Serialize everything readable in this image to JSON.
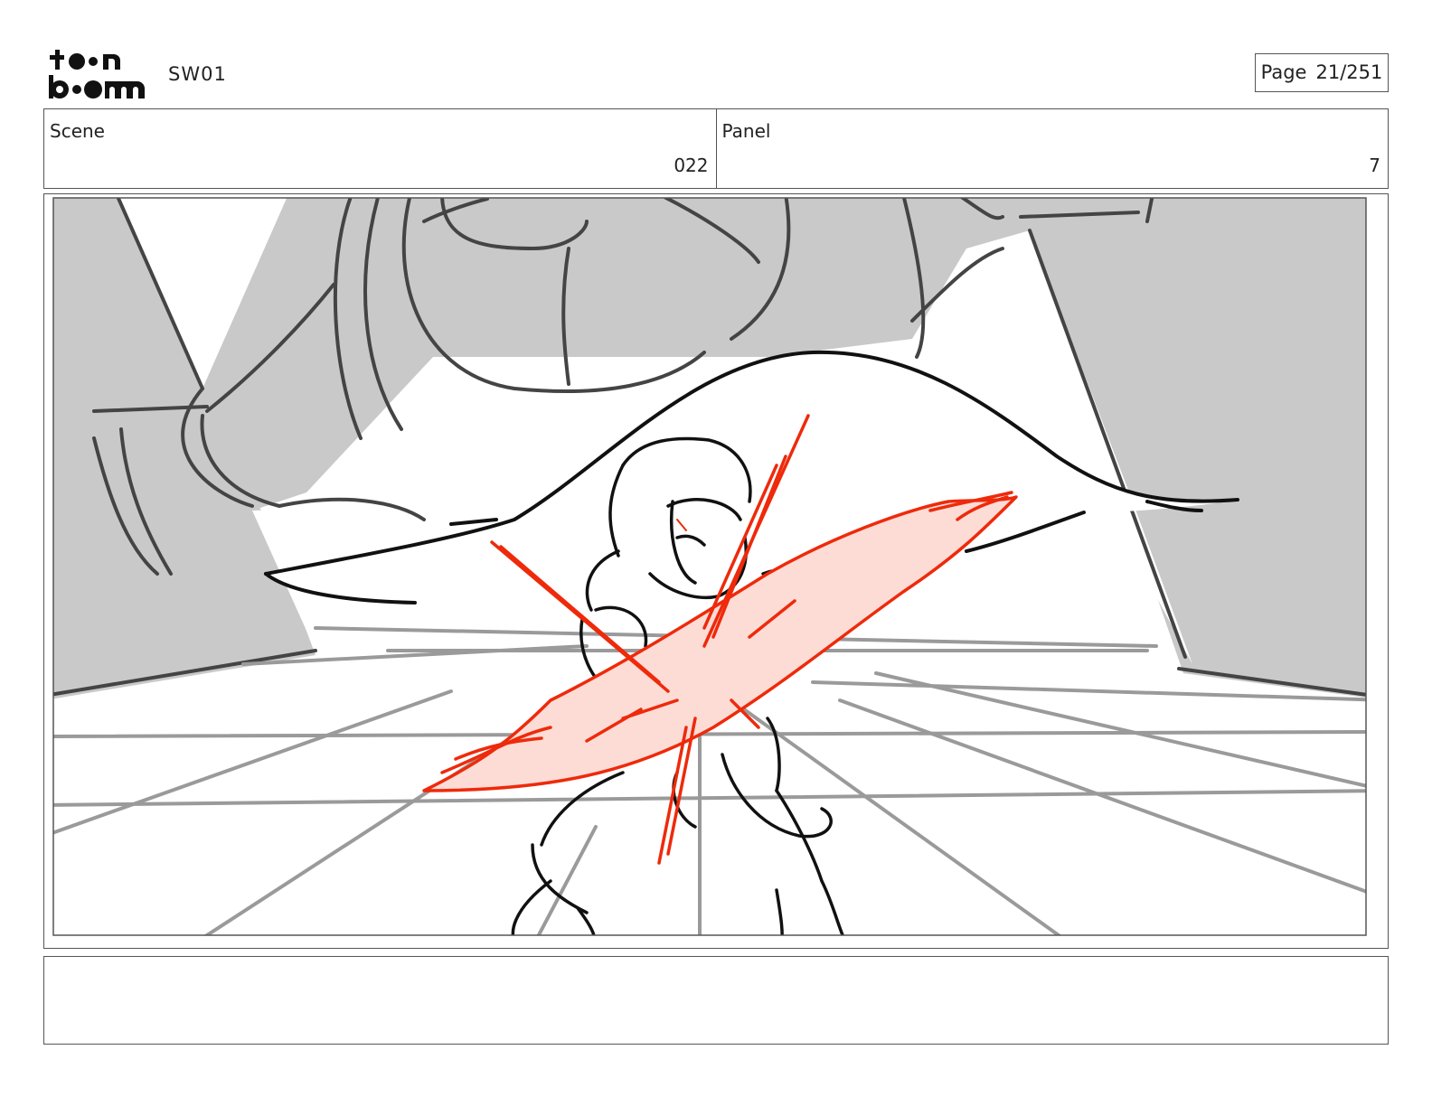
{
  "header": {
    "logo_text": "toon boom",
    "project": "SW01",
    "page_label": "Page",
    "page_value": "21/251"
  },
  "info": {
    "scene_label": "Scene",
    "scene_value": "022",
    "panel_label": "Panel",
    "panel_value": "7"
  },
  "panel": {
    "image_description": "Storyboard sketch: crouching character behind a red slash effect, gray room with a white fabric swoop overhead",
    "accent_colors": {
      "slash_stroke": "#ee2a0b",
      "slash_fill": "#fddcd6",
      "background_gray": "#c9c9c9"
    }
  },
  "notes": {
    "text": ""
  }
}
